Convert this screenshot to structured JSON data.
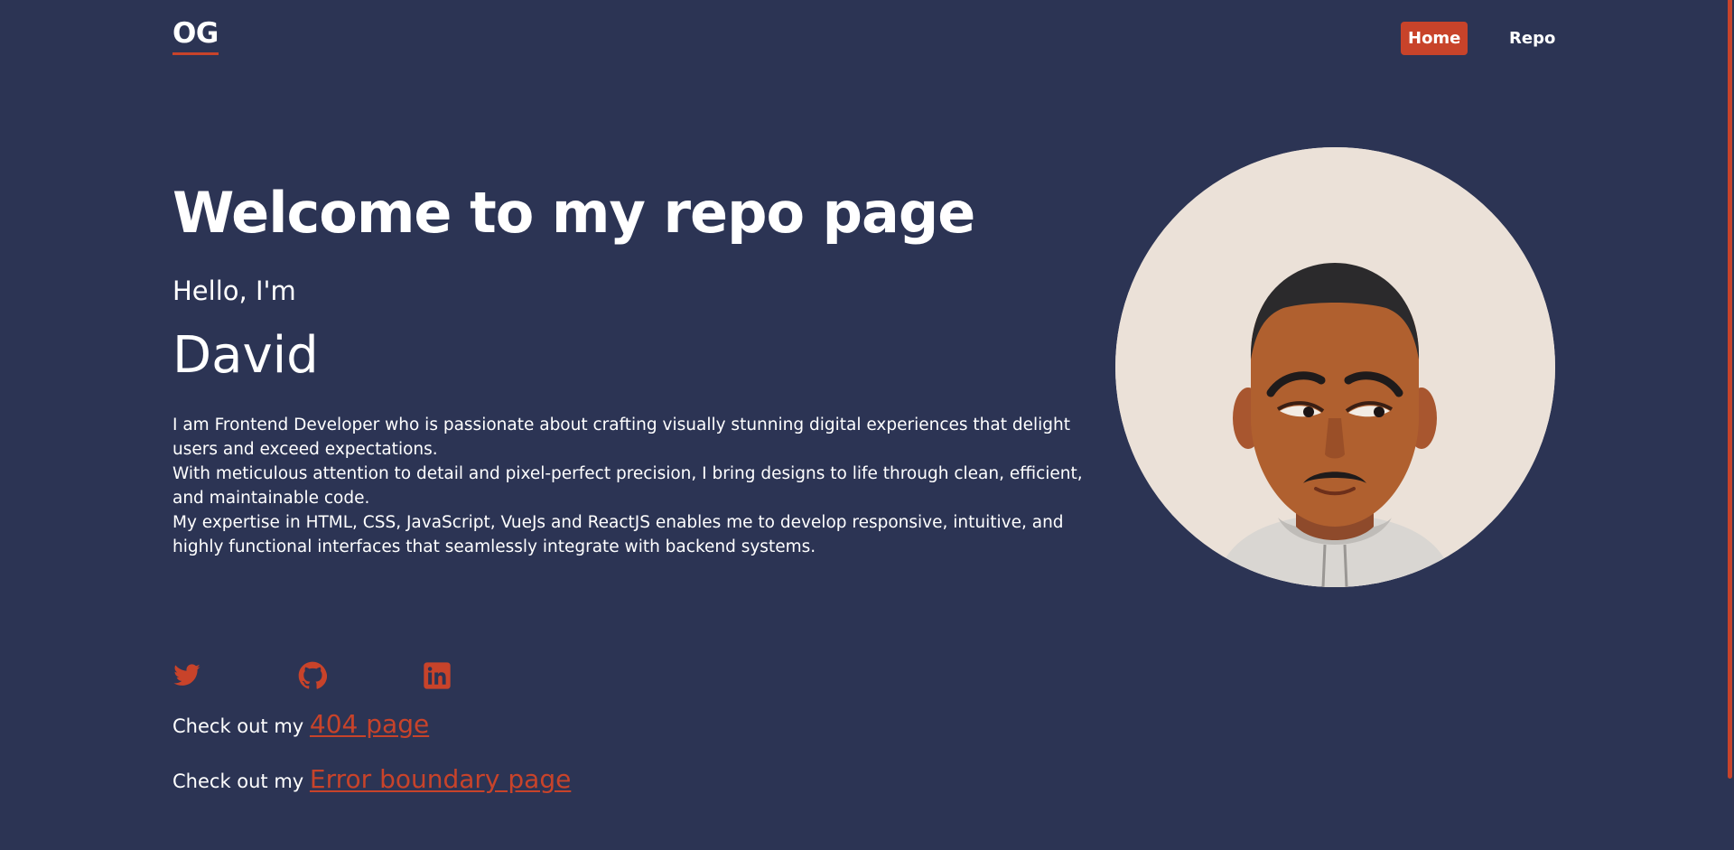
{
  "nav": {
    "logo": "OG",
    "links": [
      {
        "label": "Home",
        "active": true
      },
      {
        "label": "Repo",
        "active": false
      }
    ]
  },
  "hero": {
    "title": "Welcome to my repo page",
    "greeting": "Hello, I'm",
    "name": "David",
    "bio": [
      "I am Frontend Developer who is passionate about crafting visually stunning digital experiences that delight users and exceed expectations.",
      "With meticulous attention to detail and pixel-perfect precision, I bring designs to life through clean, efficient, and maintainable code.",
      "My expertise in HTML, CSS, JavaScript, VueJs and ReactJS enables me to develop responsive, intuitive, and highly functional interfaces that seamlessly integrate with backend systems."
    ]
  },
  "social": {
    "icons": [
      "twitter-icon",
      "github-icon",
      "linkedin-icon"
    ]
  },
  "links": {
    "notfound_prefix": "Check out my",
    "notfound_label": "404 page",
    "error_prefix": "Check out my",
    "error_label": "Error boundary page"
  },
  "colors": {
    "background": "#2c3454",
    "accent": "#c8432a",
    "text": "#ffffff",
    "avatar_bg": "#ebe1d8"
  }
}
